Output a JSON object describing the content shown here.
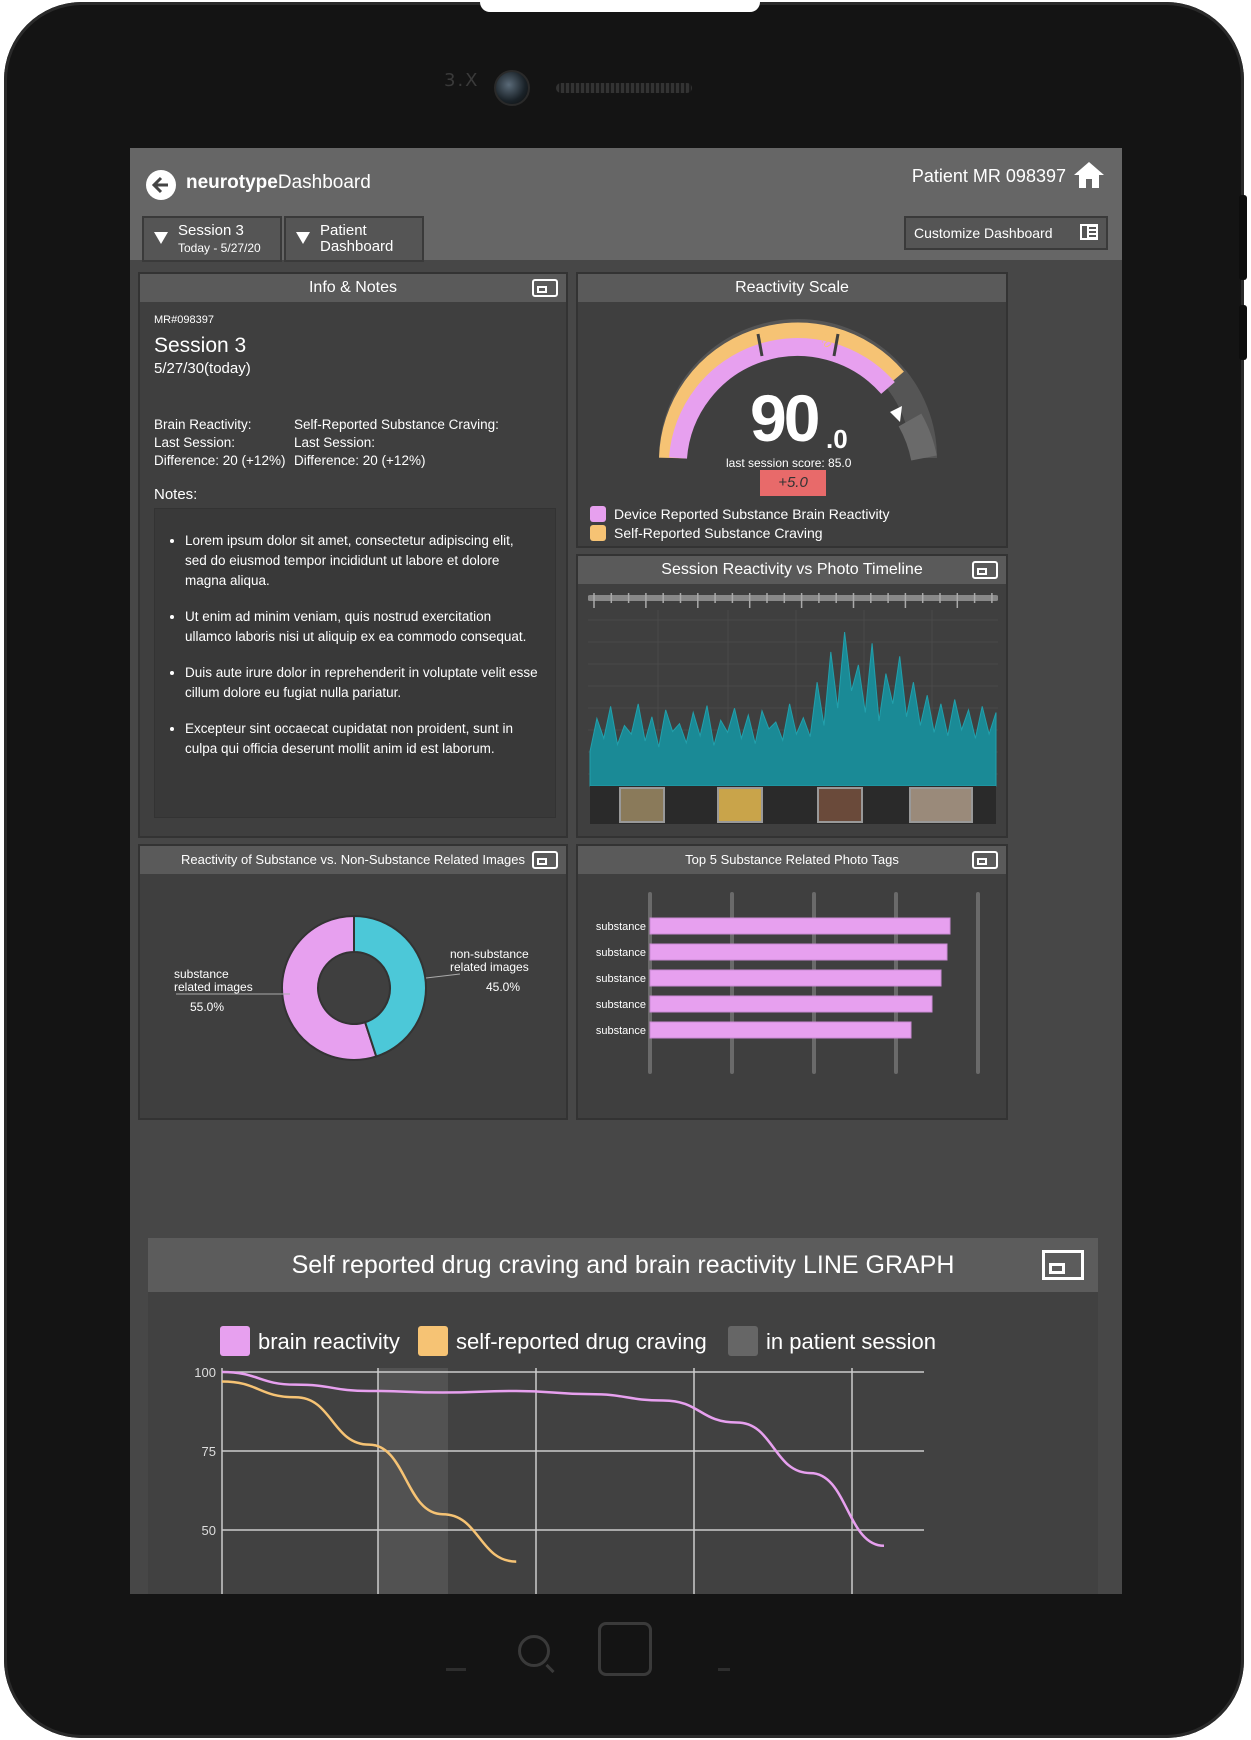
{
  "device": {
    "camera_label": "3.X"
  },
  "header": {
    "app_title_bold": "neurotype",
    "app_title_rest": "Dashboard",
    "patient": "Patient MR 098397",
    "session_select": {
      "line1": "Session 3",
      "line2": "Today - 5/27/20"
    },
    "view_select": {
      "line1": "Patient",
      "line2": "Dashboard"
    },
    "customize": "Customize Dashboard"
  },
  "info": {
    "title": "Info & Notes",
    "mr": "MR#098397",
    "session": "Session 3",
    "date": "5/27/30(today)",
    "col1": [
      "Brain Reactivity:",
      "Last Session:",
      "Difference: 20 (+12%)"
    ],
    "col2": [
      "Self-Reported Substance Craving:",
      "Last Session:",
      "Difference: 20 (+12%)"
    ],
    "notes_label": "Notes:",
    "notes": [
      "Lorem ipsum dolor sit amet, consectetur adipiscing elit, sed do eiusmod tempor incididunt ut labore et dolore magna aliqua.",
      "Ut enim ad minim veniam, quis nostrud exercitation ullamco laboris nisi ut aliquip ex ea commodo consequat.",
      "Duis aute irure dolor in reprehenderit in voluptate velit esse cillum dolore eu fugiat nulla pariatur.",
      "Excepteur sint occaecat cupidatat non proident, sunt in culpa qui officia deserunt mollit anim id est laborum."
    ]
  },
  "reactivity": {
    "title": "Reactivity Scale",
    "score_main": "90",
    "score_dec": ".0",
    "marker": "73.0",
    "last": "last session score: 85.0",
    "delta": "+5.0",
    "legend": [
      {
        "label": "Device Reported Substance Brain Reactivity",
        "color": "#e7a0ef"
      },
      {
        "label": "Self-Reported Substance Craving",
        "color": "#f6c374"
      }
    ]
  },
  "timeline": {
    "title": "Session Reactivity vs Photo Timeline"
  },
  "donut": {
    "title": "Reactivity of Substance vs. Non-Substance Related Images",
    "left_label_1": "substance",
    "left_label_2": "related images",
    "left_pct": "55.0%",
    "right_label_1": "non-substance",
    "right_label_2": "related images",
    "right_pct": "45.0%"
  },
  "tags": {
    "title": "Top 5 Substance Related Photo Tags",
    "labels": [
      "substance",
      "substance",
      "substance",
      "substance",
      "substance"
    ]
  },
  "line_graph": {
    "title": "Self reported drug craving and brain reactivity LINE GRAPH",
    "legend": [
      {
        "label": "brain reactivity",
        "color": "#e7a0ef"
      },
      {
        "label": "self-reported drug craving",
        "color": "#f6c374"
      },
      {
        "label": "in patient session",
        "color": "#666666"
      }
    ],
    "y_ticks": [
      "100",
      "75",
      "50"
    ]
  },
  "chart_data": [
    {
      "type": "pie",
      "title": "Reactivity of Substance vs. Non-Substance Related Images",
      "categories": [
        "substance related images",
        "non-substance related images"
      ],
      "values": [
        55.0,
        45.0
      ],
      "colors": [
        "#e7a0ef",
        "#4cc8d8"
      ]
    },
    {
      "type": "bar",
      "title": "Top 5 Substance Related Photo Tags",
      "categories": [
        "substance",
        "substance",
        "substance",
        "substance",
        "substance"
      ],
      "values": [
        100,
        99,
        97,
        94,
        87
      ],
      "color": "#e7a0ef"
    },
    {
      "type": "line",
      "title": "Self reported drug craving and brain reactivity LINE GRAPH",
      "ylim": [
        40,
        100
      ],
      "series": [
        {
          "name": "brain reactivity",
          "x": [
            0,
            1,
            2,
            3,
            4,
            5,
            6,
            7,
            8,
            9
          ],
          "values": [
            100,
            96,
            94,
            93.5,
            94,
            93,
            91,
            84,
            68,
            45
          ],
          "color": "#e7a0ef"
        },
        {
          "name": "self-reported drug craving",
          "x": [
            0,
            1,
            2,
            3,
            4
          ],
          "values": [
            97,
            92,
            77,
            55,
            40
          ],
          "color": "#f6c374"
        }
      ]
    },
    {
      "type": "area",
      "title": "Session Reactivity vs Photo Timeline",
      "values": [
        40,
        78,
        55,
        92,
        48,
        70,
        60,
        95,
        52,
        80,
        45,
        88,
        63,
        72,
        50,
        85,
        58,
        93,
        47,
        76,
        62,
        90,
        55,
        82,
        49,
        87,
        66,
        74,
        53,
        95,
        60,
        79,
        57,
        120,
        70,
        155,
        90,
        178,
        110,
        140,
        85,
        165,
        75,
        130,
        95,
        150,
        80,
        120,
        70,
        105,
        62,
        95,
        58,
        100,
        65,
        88,
        55,
        92,
        60,
        85
      ]
    }
  ]
}
